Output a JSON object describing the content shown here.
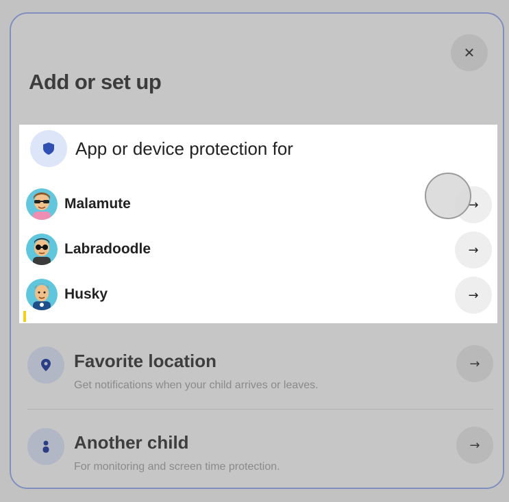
{
  "dialog": {
    "title": "Add or set up",
    "close_glyph": "✕",
    "close_icon": "close-icon"
  },
  "protection_panel": {
    "title": "App or device protection for",
    "icon": "shield-icon",
    "colors": {
      "icon_bg": "#dde5f8",
      "icon_fg": "#2f4fb5"
    },
    "children": [
      {
        "name": "Malamute",
        "avatar": "avatar-girl-sunglasses",
        "arrow": "→"
      },
      {
        "name": "Labradoodle",
        "avatar": "avatar-boy-sunglasses",
        "arrow": "→"
      },
      {
        "name": "Husky",
        "avatar": "avatar-boy-redhair",
        "arrow": "→"
      }
    ]
  },
  "options": [
    {
      "title": "Favorite location",
      "subtitle": "Get notifications when your child arrives or leaves.",
      "icon": "location-pin-icon",
      "arrow": "→"
    },
    {
      "title": "Another child",
      "subtitle": "For monitoring and screen time protection.",
      "icon": "person-icon",
      "arrow": "→"
    }
  ]
}
